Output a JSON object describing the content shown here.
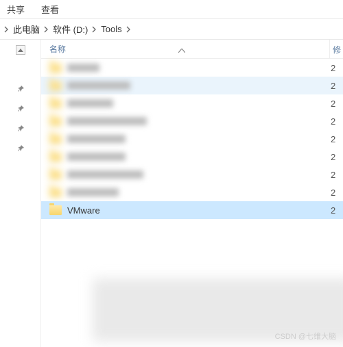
{
  "toolbar": {
    "share": "共享",
    "view": "查看"
  },
  "breadcrumb": [
    {
      "label": "此电脑"
    },
    {
      "label": "软件 (D:)"
    },
    {
      "label": "Tools"
    }
  ],
  "columns": {
    "name": "名称",
    "modified": "修"
  },
  "rows": [
    {
      "label": "",
      "blurred": true,
      "date": "2",
      "state": ""
    },
    {
      "label": "",
      "blurred": true,
      "date": "2",
      "state": "hover"
    },
    {
      "label": "",
      "blurred": true,
      "date": "2",
      "state": ""
    },
    {
      "label": "",
      "blurred": true,
      "date": "2",
      "state": ""
    },
    {
      "label": "",
      "blurred": true,
      "date": "2",
      "state": ""
    },
    {
      "label": "",
      "blurred": true,
      "date": "2",
      "state": ""
    },
    {
      "label": "",
      "blurred": true,
      "date": "2",
      "state": ""
    },
    {
      "label": "",
      "blurred": true,
      "date": "2",
      "state": ""
    },
    {
      "label": "VMware",
      "blurred": false,
      "date": "2",
      "state": "selected"
    }
  ],
  "watermark": "CSDN @七维大脑"
}
